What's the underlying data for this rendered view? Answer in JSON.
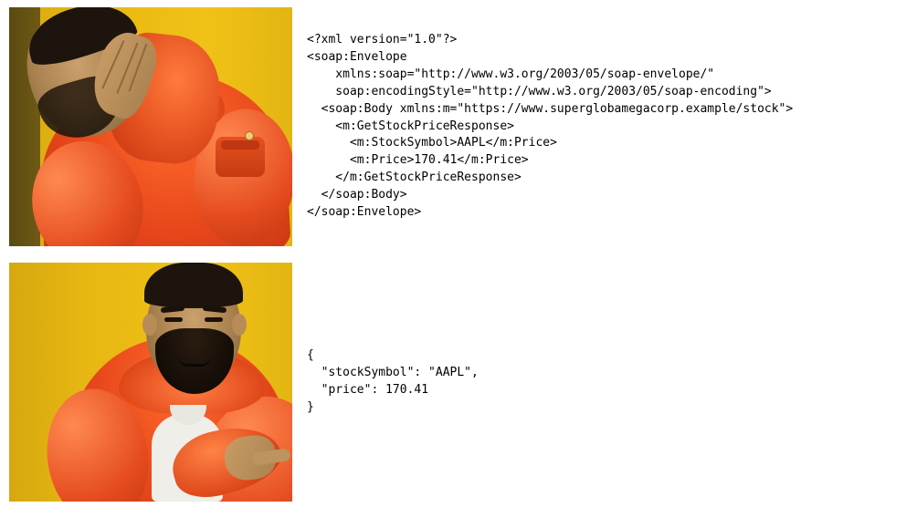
{
  "top": {
    "image_alt": "Drake disapproving",
    "code": "<?xml version=\"1.0\"?>\n<soap:Envelope\n    xmlns:soap=\"http://www.w3.org/2003/05/soap-envelope/\"\n    soap:encodingStyle=\"http://www.w3.org/2003/05/soap-encoding\">\n  <soap:Body xmlns:m=\"https://www.superglobamegacorp.example/stock\">\n    <m:GetStockPriceResponse>\n      <m:StockSymbol>AAPL</m:Price>\n      <m:Price>170.41</m:Price>\n    </m:GetStockPriceResponse>\n  </soap:Body>\n</soap:Envelope>"
  },
  "bottom": {
    "image_alt": "Drake approving",
    "code": "{\n  \"stockSymbol\": \"AAPL\",\n  \"price\": 170.41\n}"
  }
}
